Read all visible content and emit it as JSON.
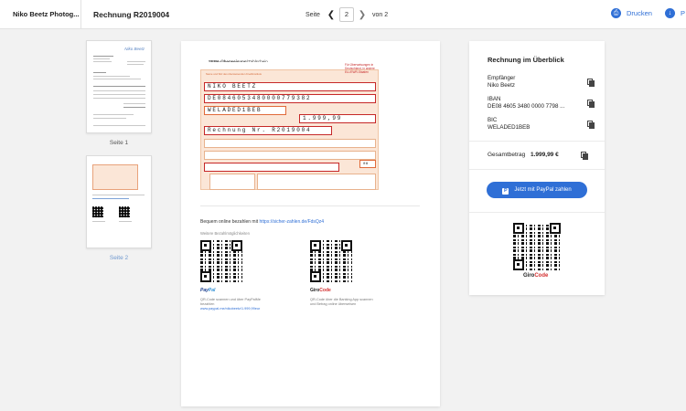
{
  "header": {
    "brand": "Niko Beetz Photog...",
    "doc_title": "Rechnung R2019004",
    "pager": {
      "prefix": "Seite",
      "current": "2",
      "suffix": "von 2"
    },
    "print_label": "Drucken",
    "download_label": "P"
  },
  "thumbnails": [
    {
      "label": "Seite 1",
      "logo": "Niko Beetz"
    },
    {
      "label": "Seite 2"
    }
  ],
  "document": {
    "sepa_title_bold": "SEPA-Überweisung",
    "sepa_title_rest": "/Zahlschein",
    "fields": {
      "recipient": "NIKO BEETZ",
      "iban": "DE0846053480000779382",
      "bic": "WELADED1BEB",
      "amount": "1.999,99",
      "reference": "Rechnung Nr. R2019004",
      "code": "08"
    },
    "form_red_note": "Für Überweisungen in Deutschland, in andere EU-/EWR-Staaten",
    "pay_online_prefix": "Bequem online bezahlen mit",
    "pay_online_link": "https://sicher-zahlen.de/FdsQz4",
    "more_options": "Weitere Bezahlmöglichkeiten",
    "paypal_brand_a": "Pay",
    "paypal_brand_b": "Pal",
    "paypal_note": "QR-Code scannen und über PayPalMe bezahlen",
    "paypal_link": "www.paypal.me/nikobeetz/1.999,99eur",
    "girocode_brand_a": "Giro",
    "girocode_brand_b": "Code",
    "girocode_note": "QR-Code über die Banking App scannen und Betrag online überweisen"
  },
  "panel": {
    "title": "Rechnung im Überblick",
    "recipient_label": "Empfänger",
    "recipient_value": "Niko Beetz",
    "iban_label": "IBAN",
    "iban_value": "DE08 4605 3480 0000 7798 ...",
    "bic_label": "BIC",
    "bic_value": "WELADED1BEB",
    "total_label": "Gesamtbetrag",
    "total_value": "1.999,99 €",
    "pay_button": "Jetzt mit PayPal zahlen",
    "girocode_a": "Giro",
    "girocode_b": "Code"
  },
  "colors": {
    "accent": "#2f6fd6",
    "sepa_red": "#c62828",
    "sepa_bg": "#fbe6d7"
  },
  "icons": [
    "chevron-left-icon",
    "chevron-right-icon",
    "print-icon",
    "download-icon",
    "copy-icon",
    "paypal-icon",
    "qr-code-icon"
  ]
}
